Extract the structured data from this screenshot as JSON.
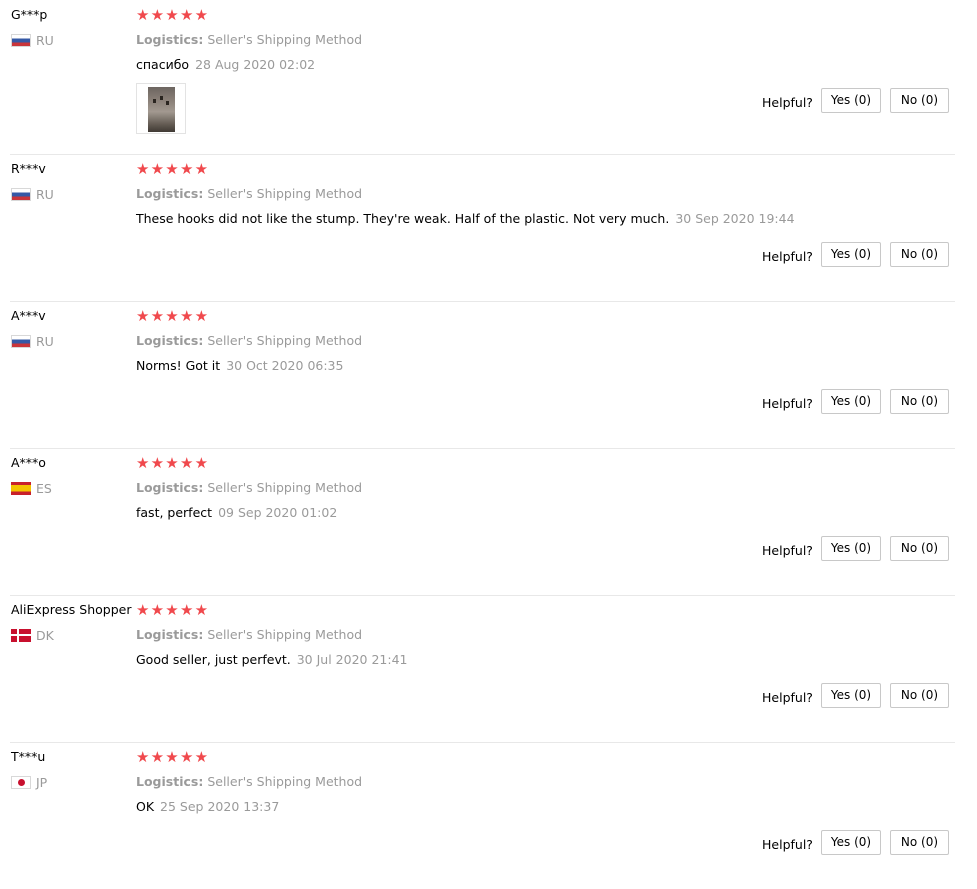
{
  "reviews": [
    {
      "user": "G***p",
      "country": "RU",
      "flag": "ru",
      "rating": "★★★★★",
      "logistics_label": "Logistics:",
      "logistics_value": "Seller's Shipping Method",
      "comment": "спасибо",
      "date": "28 Aug 2020 02:02",
      "has_photo": true,
      "helpful_label": "Helpful?",
      "yes_label": "Yes (0)",
      "no_label": "No (0)"
    },
    {
      "user": "R***v",
      "country": "RU",
      "flag": "ru",
      "rating": "★★★★★",
      "logistics_label": "Logistics:",
      "logistics_value": "Seller's Shipping Method",
      "comment": "These hooks did not like the stump. They're weak. Half of the plastic. Not very much.",
      "date": "30 Sep 2020 19:44",
      "has_photo": false,
      "helpful_label": "Helpful?",
      "yes_label": "Yes (0)",
      "no_label": "No (0)"
    },
    {
      "user": "A***v",
      "country": "RU",
      "flag": "ru",
      "rating": "★★★★★",
      "logistics_label": "Logistics:",
      "logistics_value": "Seller's Shipping Method",
      "comment": "Norms! Got it",
      "date": "30 Oct 2020 06:35",
      "has_photo": false,
      "helpful_label": "Helpful?",
      "yes_label": "Yes (0)",
      "no_label": "No (0)"
    },
    {
      "user": "A***o",
      "country": "ES",
      "flag": "es",
      "rating": "★★★★★",
      "logistics_label": "Logistics:",
      "logistics_value": "Seller's Shipping Method",
      "comment": "fast, perfect",
      "date": "09 Sep 2020 01:02",
      "has_photo": false,
      "helpful_label": "Helpful?",
      "yes_label": "Yes (0)",
      "no_label": "No (0)"
    },
    {
      "user": "AliExpress Shopper",
      "country": "DK",
      "flag": "dk",
      "rating": "★★★★★",
      "logistics_label": "Logistics:",
      "logistics_value": "Seller's Shipping Method",
      "comment": "Good seller, just perfevt.",
      "date": "30 Jul 2020 21:41",
      "has_photo": false,
      "helpful_label": "Helpful?",
      "yes_label": "Yes (0)",
      "no_label": "No (0)"
    },
    {
      "user": "T***u",
      "country": "JP",
      "flag": "jp",
      "rating": "★★★★★",
      "logistics_label": "Logistics:",
      "logistics_value": "Seller's Shipping Method",
      "comment": "OK",
      "date": "25 Sep 2020 13:37",
      "has_photo": false,
      "helpful_label": "Helpful?",
      "yes_label": "Yes (0)",
      "no_label": "No (0)"
    }
  ],
  "colors": {
    "star": "#f0494d",
    "muted_text": "#9a9a9a",
    "separator": "#e8e8e8",
    "button_border": "#c8c8c8"
  }
}
